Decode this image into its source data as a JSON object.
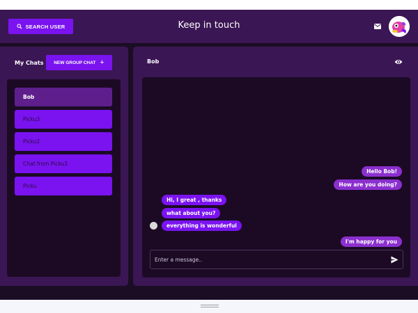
{
  "header": {
    "search_label": "SEARCH USER",
    "title": "Keep in touch"
  },
  "sidebar": {
    "heading": "My Chats",
    "new_group_label": "NEW GROUP CHAT",
    "chats": [
      {
        "label": "Bob",
        "active": true
      },
      {
        "label": "Picku3",
        "active": false
      },
      {
        "label": "Picku2",
        "active": false
      },
      {
        "label": "Chat from Picku3",
        "active": false
      },
      {
        "label": "Picku",
        "active": false
      }
    ]
  },
  "chat": {
    "title": "Bob",
    "messages": [
      {
        "text": "Hello Bob!",
        "sender": "me"
      },
      {
        "text": "How are you doing?",
        "sender": "me"
      },
      {
        "text": "Hi, I great , thanks",
        "sender": "other"
      },
      {
        "text": "what about you?",
        "sender": "other"
      },
      {
        "text": "everything is wonderful",
        "sender": "other"
      },
      {
        "text": "I'm happy for you",
        "sender": "me"
      }
    ],
    "input_placeholder": "Enter a message.."
  },
  "colors": {
    "accent": "#7a13f0",
    "panel": "#3b1654",
    "background": "#1b0d24",
    "selected_chat": "#5e1f8c"
  },
  "icons": [
    "search-icon",
    "mail-icon",
    "avatar",
    "plus-icon",
    "eye-icon",
    "send-icon",
    "drag-handle-icon"
  ]
}
